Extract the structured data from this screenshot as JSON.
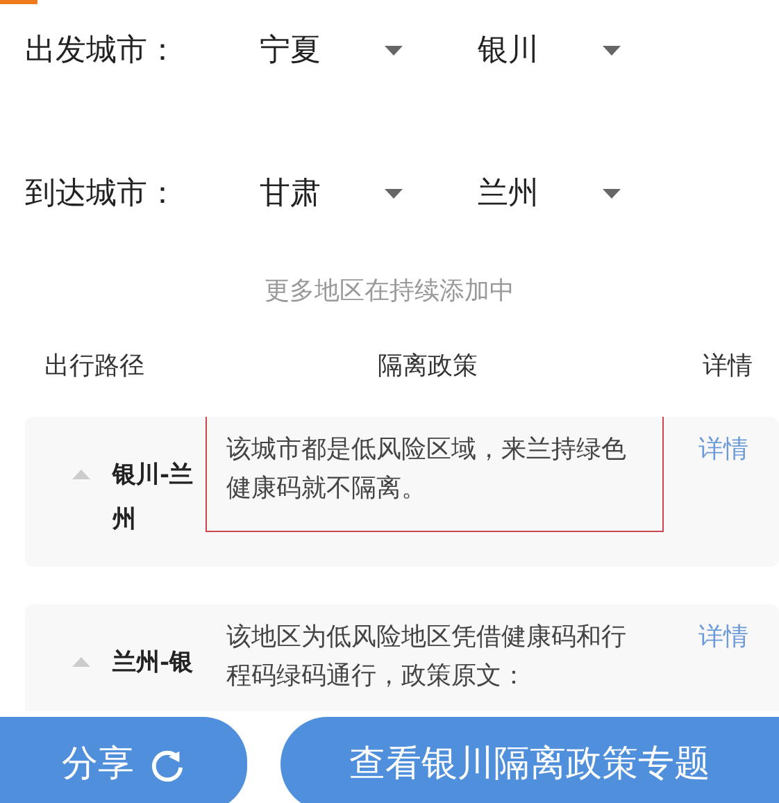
{
  "departure": {
    "label": "出发城市：",
    "province": "宁夏",
    "city": "银川"
  },
  "arrival": {
    "label": "到达城市：",
    "province": "甘肃",
    "city": "兰州"
  },
  "note": "更多地区在持续添加中",
  "table": {
    "columns": [
      "出行路径",
      "隔离政策",
      "详情"
    ],
    "rows": [
      {
        "route": "银川-兰州",
        "policy": "该城市都是低风险区域，来兰持绿色健康码就不隔离。",
        "link": "详情",
        "highlighted": true
      },
      {
        "route": "兰州-银",
        "policy": "该地区为低风险地区凭借健康码和行程码绿码通行，政策原文：",
        "link": "详情",
        "highlighted": false
      }
    ]
  },
  "buttons": [
    {
      "label": "分享",
      "kind": "share"
    },
    {
      "label": "查看银川隔离政策专题",
      "kind": "plain"
    }
  ]
}
